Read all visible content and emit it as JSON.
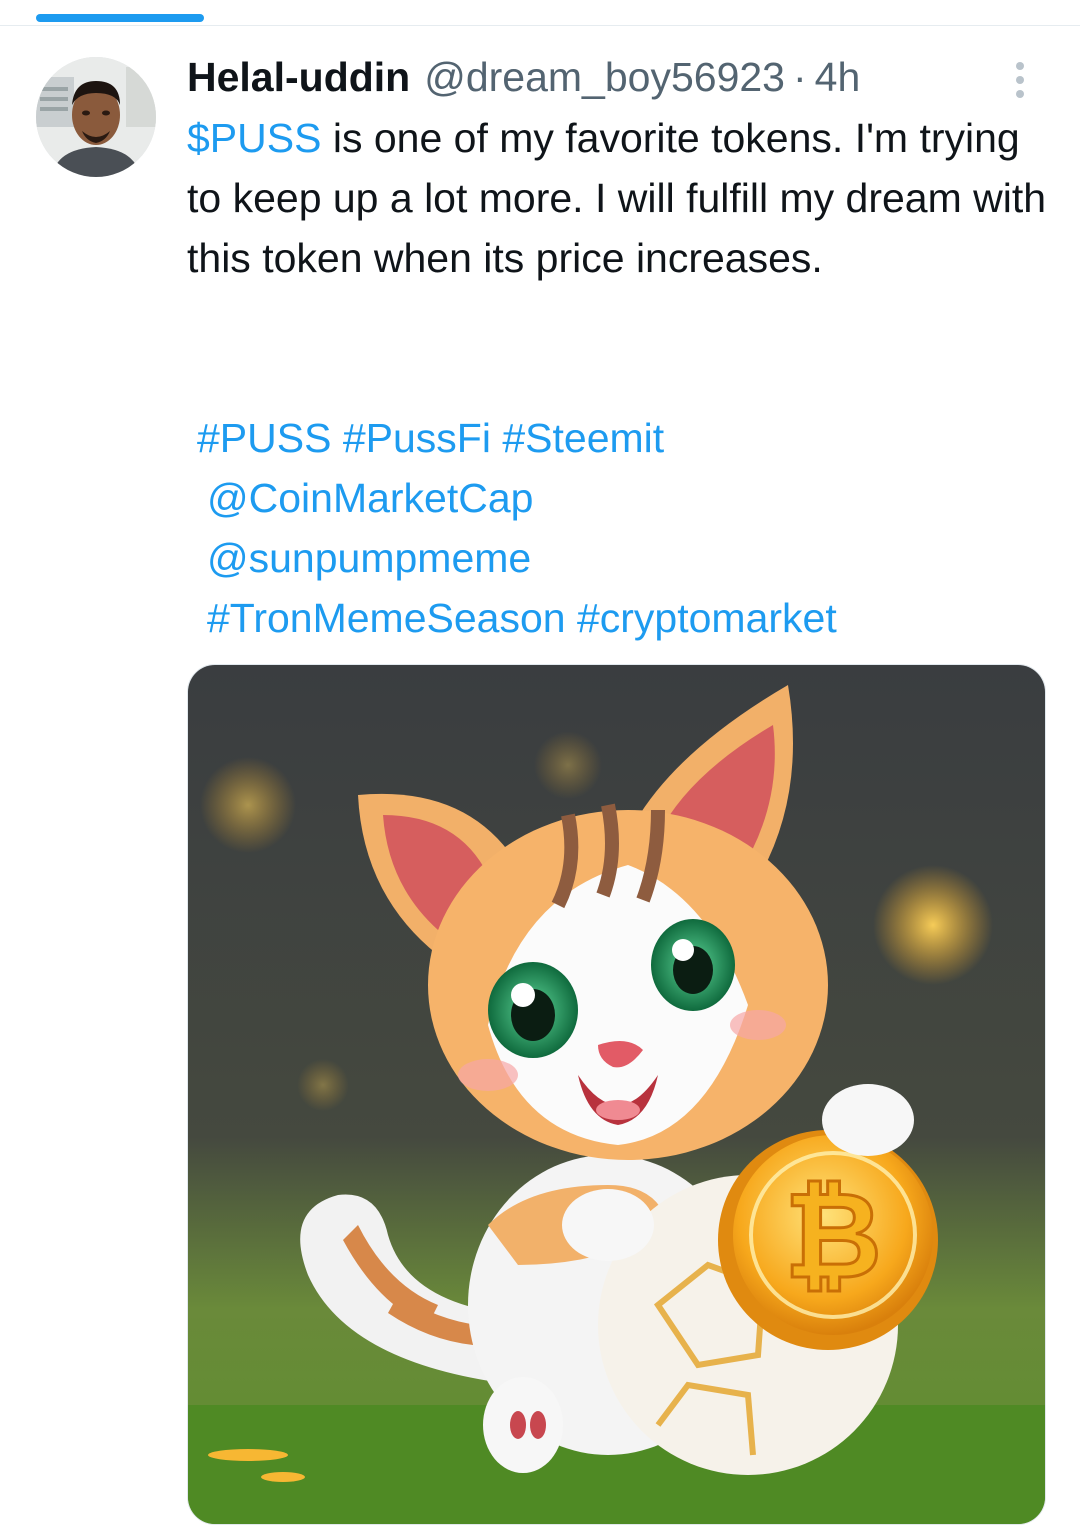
{
  "tweet": {
    "author": {
      "display_name": "Helal-uddin",
      "handle": "@dream_boy56923",
      "avatar_icon": "user-photo"
    },
    "separator": "·",
    "time": "4h",
    "more_icon": "more-vertical-icon",
    "text": {
      "cashtag": "$PUSS",
      "rest": " is one of my favorite tokens.  I'm trying to keep up a lot more.  I will fulfill my dream with this token when its price increases."
    },
    "tags": {
      "line1": [
        "#PUSS",
        "#PussFi",
        "#Steemit"
      ],
      "line2": "@CoinMarketCap",
      "line3": "@sunpumpmeme",
      "line4": [
        "#TronMemeSeason",
        "#cryptomarket"
      ]
    },
    "media": {
      "description_icon": "cartoon-kitten-with-bitcoin-coin-image",
      "coin_symbol": "₿"
    }
  },
  "colors": {
    "accent": "#1d9bf0",
    "text": "#0f1419",
    "secondary": "#536471"
  }
}
